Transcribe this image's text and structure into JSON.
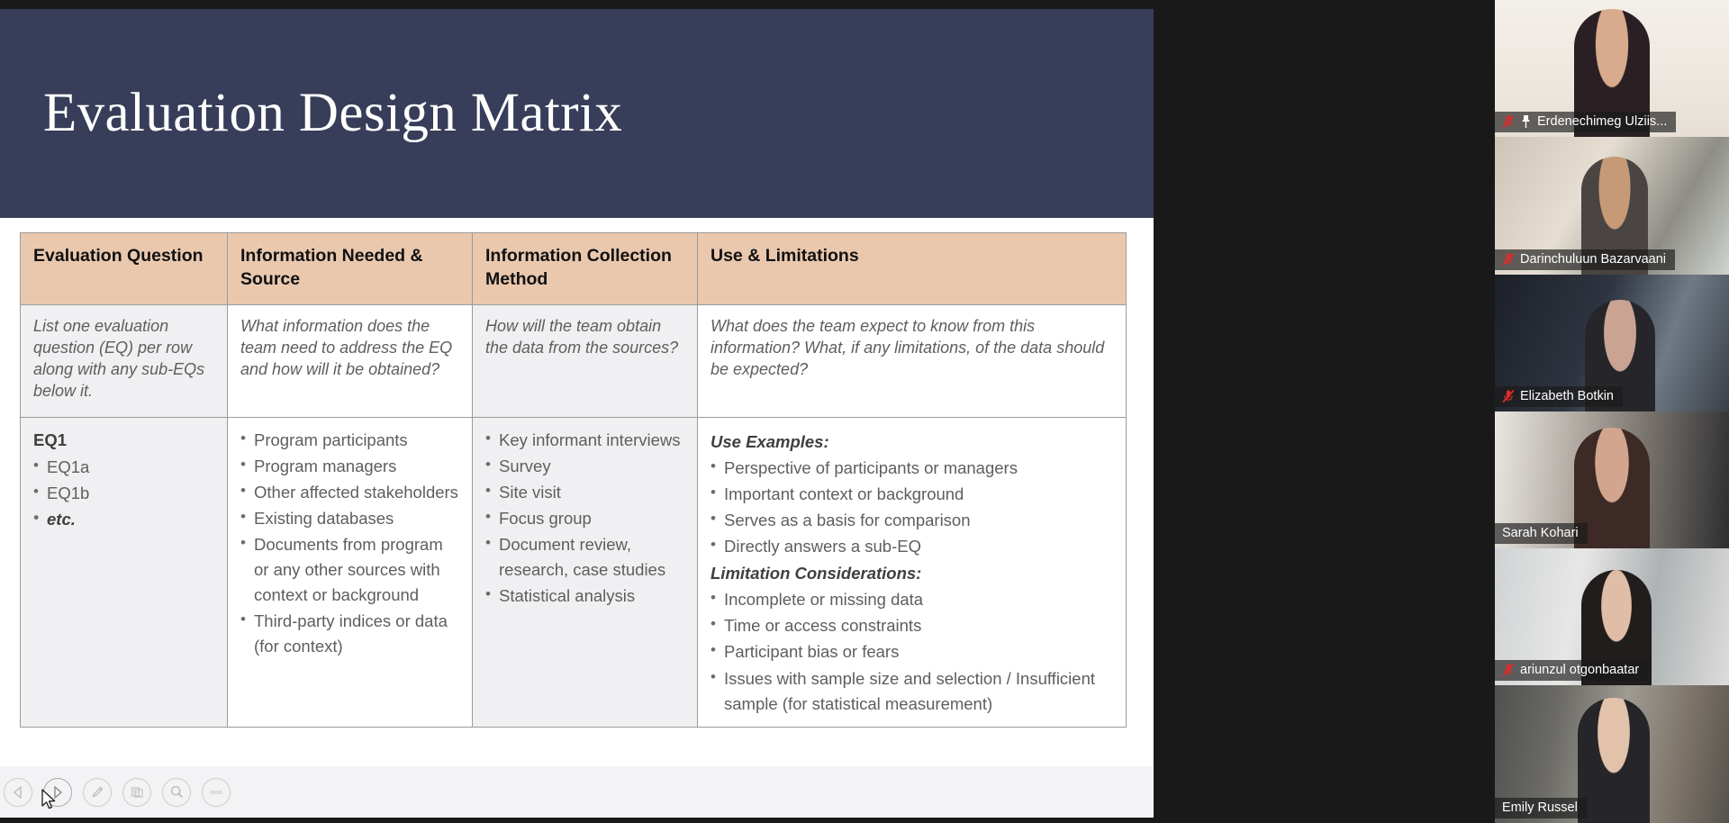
{
  "slide": {
    "title": "Evaluation Design Matrix",
    "header_bg": "#383d59",
    "header_accent": "#eac8ae",
    "table": {
      "headers": [
        "Evaluation Question",
        "Information Needed & Source",
        "Information Collection Method",
        "Use & Limitations"
      ],
      "instructions": [
        "List one evaluation question (EQ) per row along with any sub-EQs below it.",
        "What information does the team need to address the EQ and how will it be obtained?",
        "How will the team obtain the data from the sources?",
        "What does the team expect to know from  this information? What, if any limitations, of the data should be expected?"
      ],
      "body": {
        "col1": {
          "heading": "EQ1",
          "bullets": [
            "EQ1a",
            "EQ1b",
            "etc."
          ]
        },
        "col2": {
          "bullets": [
            "Program participants",
            "Program managers",
            "Other affected stakeholders",
            "Existing databases",
            "Documents from program or any other sources with context or background",
            "Third-party indices or data (for context)"
          ]
        },
        "col3": {
          "bullets": [
            "Key informant interviews",
            "Survey",
            "Site visit",
            "Focus group",
            "Document review, research, case studies",
            "Statistical analysis"
          ]
        },
        "col4": {
          "use_heading": "Use Examples:",
          "use_bullets": [
            "Perspective of participants or managers",
            "Important context or background",
            "Serves as a basis for comparison",
            "Directly answers a sub-EQ"
          ],
          "limitation_heading": "Limitation Considerations:",
          "limitation_bullets": [
            "Incomplete or missing data",
            "Time  or access constraints",
            "Participant bias or fears",
            "Issues with sample size and selection / Insufficient sample (for statistical measurement)"
          ]
        }
      }
    }
  },
  "toolbar": {
    "buttons": [
      {
        "name": "previous-slide-button",
        "icon": "triangle-left-icon"
      },
      {
        "name": "next-slide-button",
        "icon": "triangle-right-icon"
      },
      {
        "name": "annotate-button",
        "icon": "pen-icon"
      },
      {
        "name": "slides-button",
        "icon": "copy-icon"
      },
      {
        "name": "zoom-button",
        "icon": "magnifier-icon"
      },
      {
        "name": "more-options-button",
        "icon": "ellipsis-icon"
      }
    ]
  },
  "filmstrip": {
    "active_border_color": "#8fd400",
    "participants": [
      {
        "name": "Erdenechimeg Ulziis...",
        "muted": true,
        "pinned": true,
        "active": false
      },
      {
        "name": "Darinchuluun Bazarvaani",
        "muted": true,
        "pinned": false,
        "active": false
      },
      {
        "name": "Elizabeth Botkin",
        "muted": true,
        "pinned": false,
        "active": false
      },
      {
        "name": "Sarah Kohari",
        "muted": false,
        "pinned": false,
        "active": false
      },
      {
        "name": "ariunzul otgonbaatar",
        "muted": true,
        "pinned": false,
        "active": false
      },
      {
        "name": "Emily Russel",
        "muted": false,
        "pinned": false,
        "active": true
      }
    ]
  }
}
